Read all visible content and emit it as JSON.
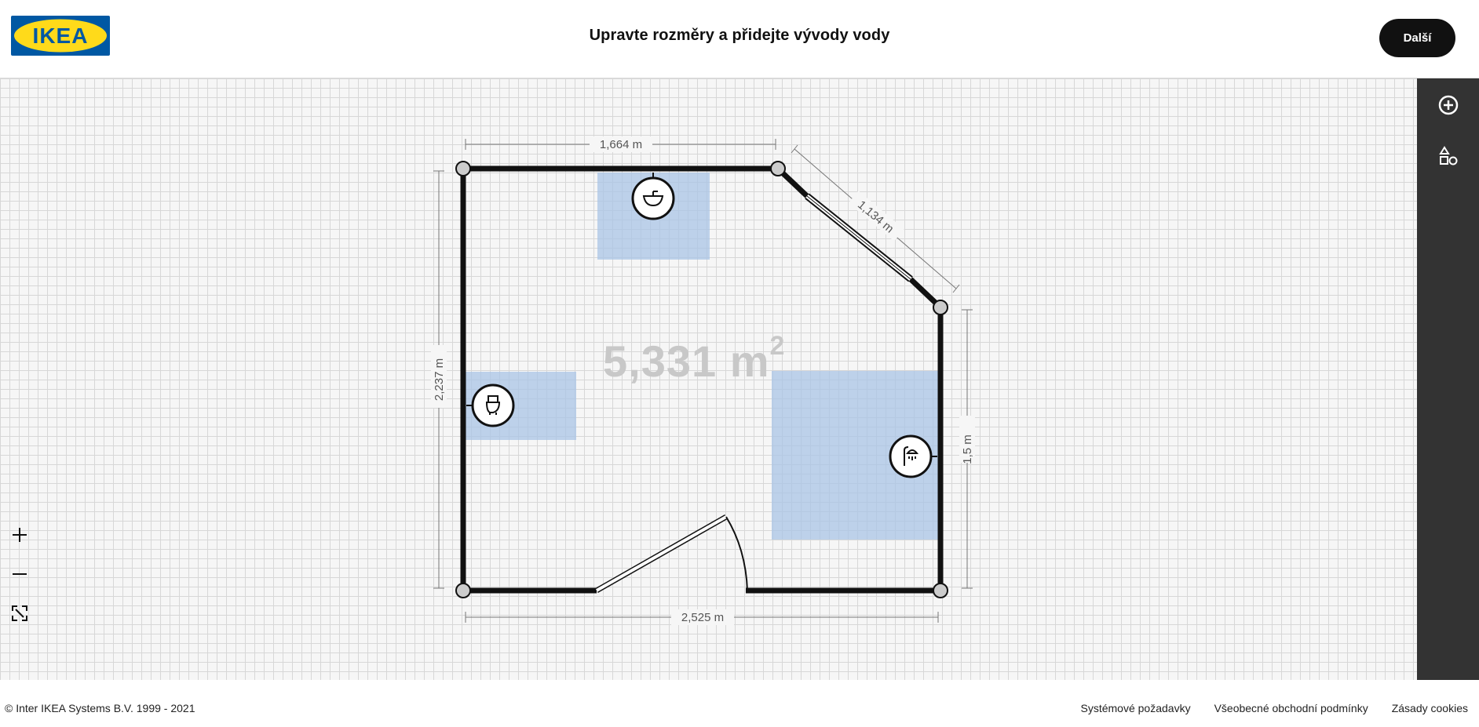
{
  "header": {
    "logo_text": "IKEA",
    "title": "Upravte rozměry a přidejte vývody vody",
    "next_label": "Další"
  },
  "plan": {
    "area": "5,331 m",
    "area_unit_sup": "2",
    "dimensions": {
      "top": "1,664 m",
      "diagonal": "1,134 m",
      "left": "2,237 m",
      "right": "1,5 m",
      "bottom": "2,525 m"
    },
    "fixtures": [
      "sink-icon",
      "toilet-icon",
      "shower-icon"
    ]
  },
  "toolbar": {
    "items": [
      "add-circle-icon",
      "shapes-icon"
    ]
  },
  "zoom": {
    "items": [
      "zoom-in-icon",
      "zoom-out-icon",
      "fit-screen-icon"
    ]
  },
  "footer": {
    "copyright": "© Inter IKEA Systems B.V. 1999 - 2021",
    "links": [
      "Systémové požadavky",
      "Všeobecné obchodní podmínky",
      "Zásady cookies"
    ]
  },
  "colors": {
    "wall": "#111111",
    "zone": "#aac4e6",
    "accent": "#0058a3",
    "logo_yellow": "#ffda1a",
    "toolbar": "#333333"
  }
}
